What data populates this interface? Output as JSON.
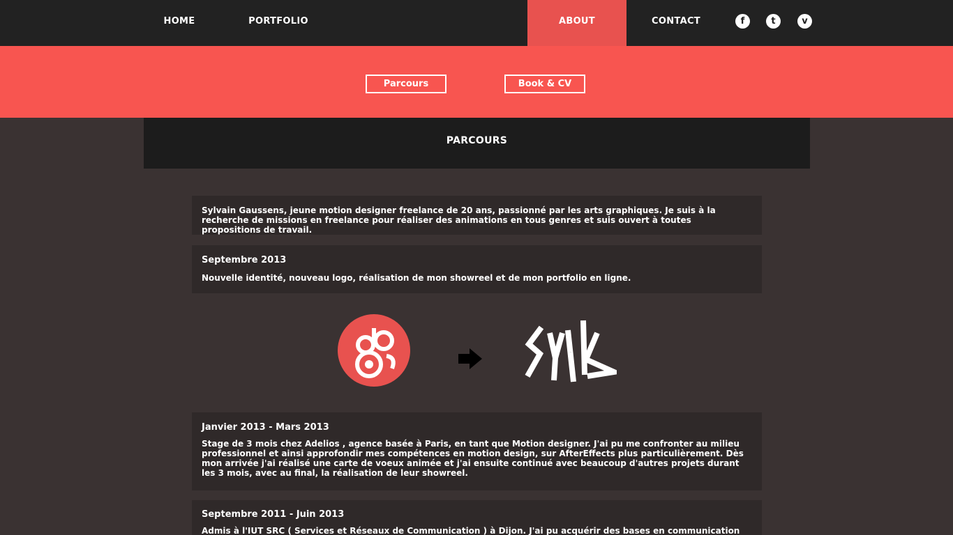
{
  "nav": {
    "home": "HOME",
    "portfolio": "PORTFOLIO",
    "about": "ABOUT",
    "contact": "CONTACT",
    "social": [
      {
        "icon": "facebook-icon",
        "glyph": "f"
      },
      {
        "icon": "twitter-icon",
        "glyph": "t"
      },
      {
        "icon": "vimeo-icon",
        "glyph": "v"
      }
    ]
  },
  "subnav": {
    "parcours": "Parcours",
    "book_cv": "Book & CV"
  },
  "section": {
    "title": "PARCOURS"
  },
  "intro": {
    "text": "Sylvain Gaussens, jeune motion designer freelance de 20 ans, passionné par les arts graphiques. Je suis à la recherche de missions en freelance pour réaliser des animations en tous genres et suis ouvert à toutes propositions de travail."
  },
  "entries": [
    {
      "date": "Septembre 2013",
      "text": "Nouvelle identité, nouveau logo, réalisation de mon showreel et de mon portfolio en ligne."
    },
    {
      "date": "Janvier 2013 - Mars 2013",
      "text": "Stage de 3 mois chez Adelios , agence basée à Paris, en tant que Motion designer. J'ai pu me confronter au milieu professionnel et ainsi approfondir mes compétences en motion design, sur AfterEffects plus particulièrement. Dès mon arrivée j'ai réalisé une carte de voeux animée et j'ai ensuite continué avec beaucoup d'autres projets durant les 3 mois, avec au final, la réalisation de leur showreel."
    },
    {
      "date": "Septembre 2011 - Juin 2013",
      "text": "Admis à l'IUT SRC ( Services et Réseaux de Communication ) à Dijon. J'ai pu acquérir des bases en communication ainsi que en"
    }
  ],
  "logos": {
    "old_logo_text": "gs",
    "new_logo_text": "SYLK"
  },
  "colors": {
    "accent": "#f85550",
    "nav_bg": "#222222",
    "page_bg": "#3a3232",
    "block_bg": "#2f2929"
  }
}
